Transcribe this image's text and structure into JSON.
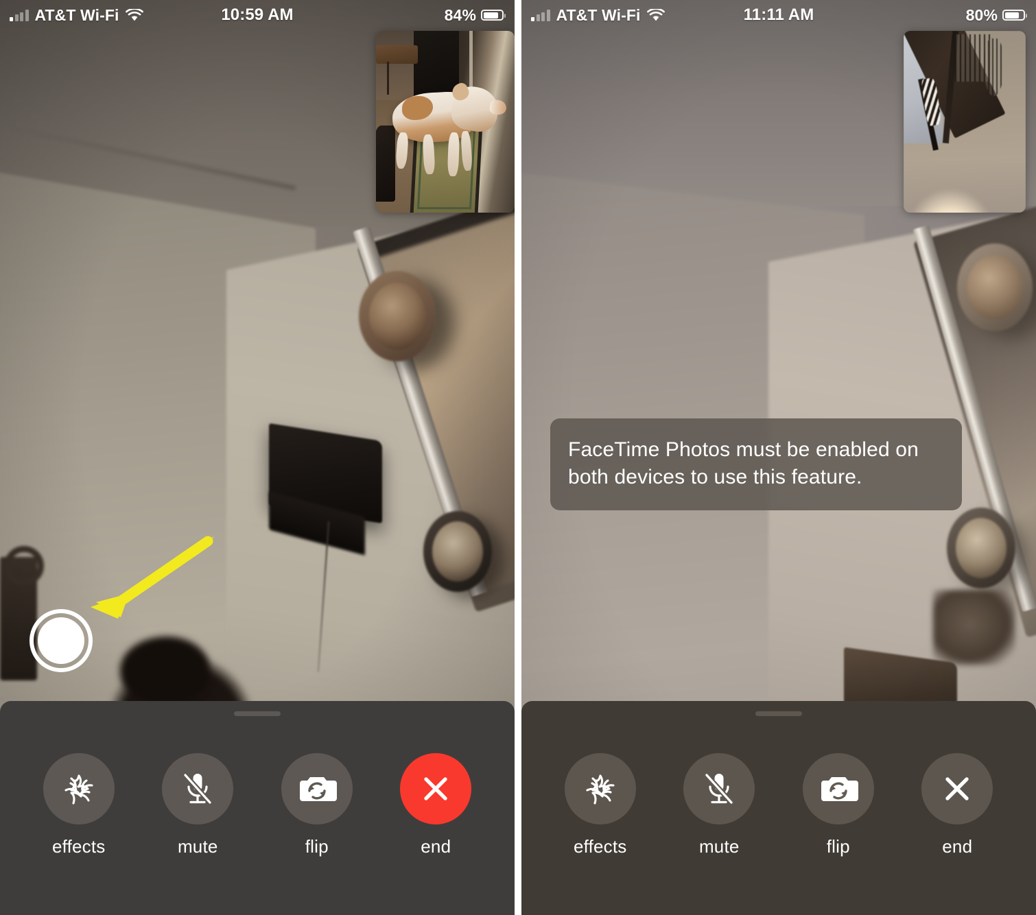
{
  "panels": [
    {
      "id": "before",
      "status_bar": {
        "carrier": "AT&T Wi-Fi",
        "signal_icon": "cellular-bars-icon",
        "wifi_icon": "wifi-icon",
        "time": "10:59 AM",
        "battery_percent": "84%",
        "battery_icon": "battery-icon"
      },
      "pip": {
        "name": "self-view-thumbnail",
        "description": "brown and white dog standing on a rug near a doorway"
      },
      "main_video": {
        "description": "dim room interior with decorative wall plates, a dark shelf and a framed picture"
      },
      "shutter": {
        "name": "facetime-live-photo-shutter-button",
        "state": "enabled"
      },
      "annotation": {
        "type": "arrow",
        "color": "#F2EA1E",
        "points_to": "facetime-live-photo-shutter-button"
      },
      "toast": null,
      "tray": {
        "grabber": "drag-handle",
        "buttons": [
          {
            "id": "effects",
            "label": "effects",
            "icon": "effects-star-icon"
          },
          {
            "id": "mute",
            "label": "mute",
            "icon": "microphone-muted-icon"
          },
          {
            "id": "flip",
            "label": "flip",
            "icon": "camera-flip-icon"
          },
          {
            "id": "end",
            "label": "end",
            "icon": "close-x-icon",
            "color": "#F9392D"
          }
        ]
      }
    },
    {
      "id": "after",
      "status_bar": {
        "carrier": "AT&T Wi-Fi",
        "signal_icon": "cellular-bars-icon",
        "wifi_icon": "wifi-icon",
        "time": "11:11 AM",
        "battery_percent": "80%",
        "battery_icon": "battery-icon"
      },
      "pip": {
        "name": "self-view-thumbnail",
        "description": "blurry view of a table leg and carpeted floor with a bright lamp flare"
      },
      "main_video": {
        "description": "brighter room interior with decorative wall plates and a framed picture"
      },
      "shutter": {
        "name": "facetime-live-photo-shutter-button",
        "state": "disabled"
      },
      "annotation": null,
      "toast": {
        "name": "facetime-photos-alert",
        "message": "FaceTime Photos must be enabled on both devices to use this feature."
      },
      "tray": {
        "grabber": "drag-handle",
        "buttons": [
          {
            "id": "effects",
            "label": "effects",
            "icon": "effects-star-icon"
          },
          {
            "id": "mute",
            "label": "mute",
            "icon": "microphone-muted-icon"
          },
          {
            "id": "flip",
            "label": "flip",
            "icon": "camera-flip-icon"
          },
          {
            "id": "end",
            "label": "end",
            "icon": "close-x-icon",
            "color": "#F9392D"
          }
        ]
      }
    }
  ]
}
